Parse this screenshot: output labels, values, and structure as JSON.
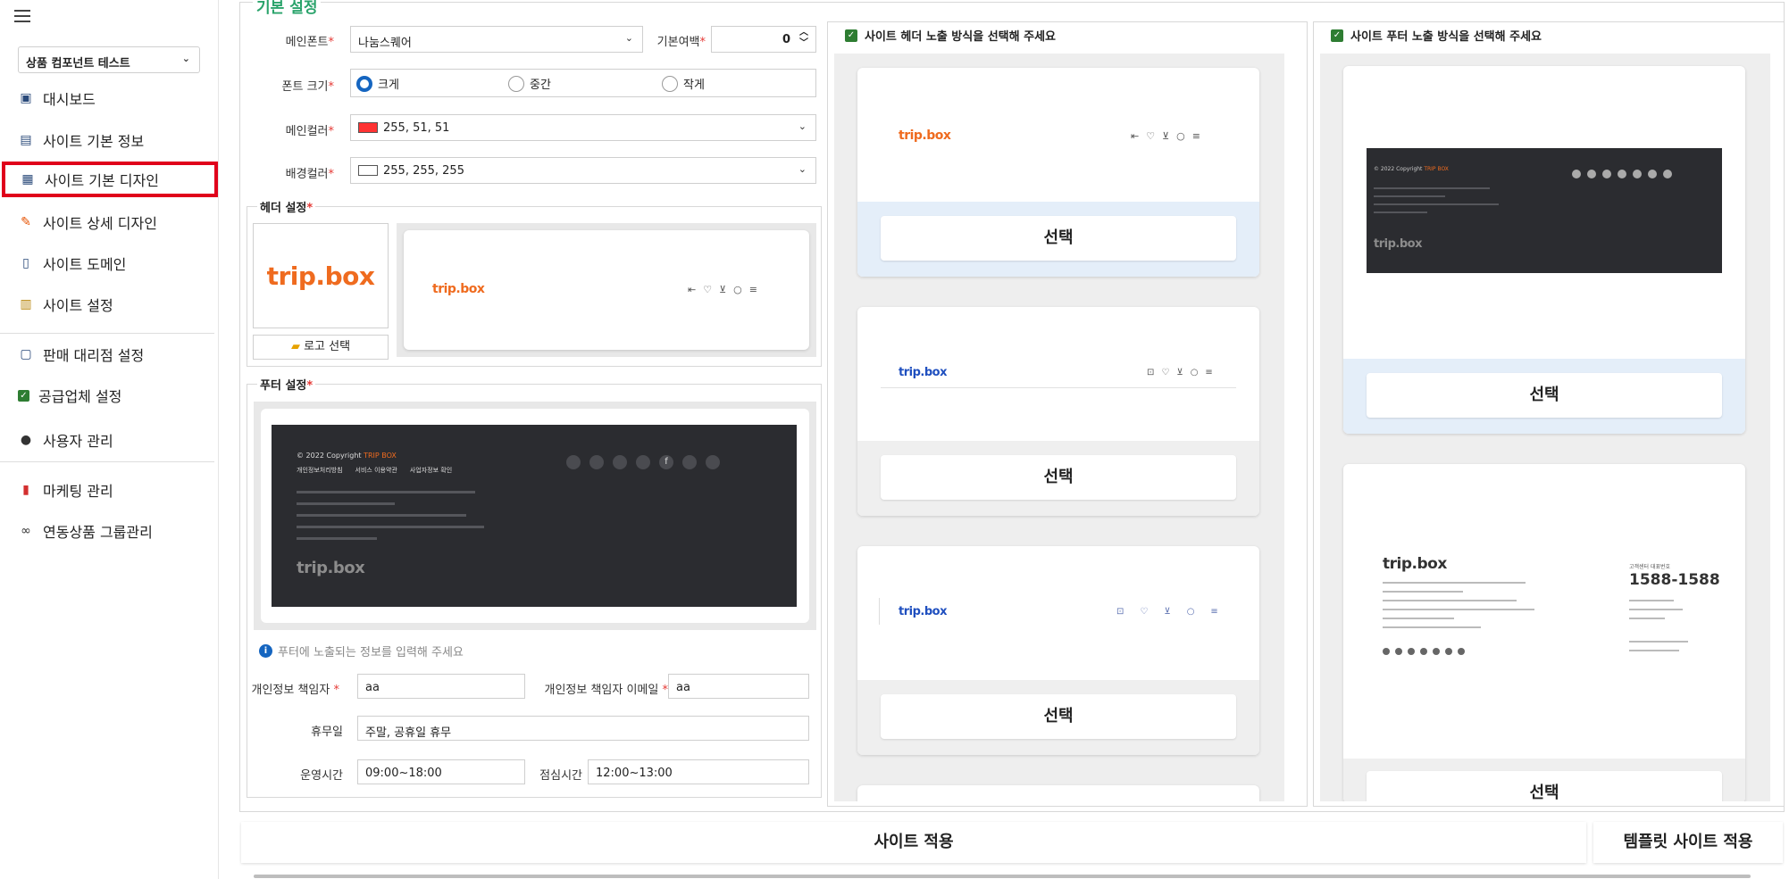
{
  "sidebar": {
    "company_select": "상품 컴포넌트 테스트",
    "items": [
      {
        "label": "대시보드",
        "icon": "dashboard-icon"
      },
      {
        "label": "사이트 기본 정보",
        "icon": "id-card-icon"
      },
      {
        "label": "사이트 기본 디자인",
        "icon": "design-icon"
      },
      {
        "label": "사이트 상세 디자인",
        "icon": "pencil-icon"
      },
      {
        "label": "사이트 도메인",
        "icon": "domain-icon"
      },
      {
        "label": "사이트 설정",
        "icon": "settings-icon"
      },
      {
        "label": "판매 대리점 설정",
        "icon": "store-icon"
      },
      {
        "label": "공급업체 설정",
        "icon": "check-icon"
      },
      {
        "label": "사용자 관리",
        "icon": "user-icon"
      },
      {
        "label": "마케팅 관리",
        "icon": "bookmark-icon"
      },
      {
        "label": "연동상품 그룹관리",
        "icon": "link-icon"
      }
    ],
    "active_index": 2
  },
  "basic": {
    "section_title": "기본 설정",
    "main_font_label": "메인폰트",
    "main_font_value": "나눔스퀘어",
    "margin_label": "기본여백",
    "margin_value": "0",
    "font_size_label": "폰트 크기",
    "font_size_options": [
      "크게",
      "중간",
      "작게"
    ],
    "font_size_selected": 0,
    "main_color_label": "메인컬러",
    "main_color_value": "255, 51, 51",
    "main_color_hex": "#ff3333",
    "bg_color_label": "배경컬러",
    "bg_color_value": "255, 255, 255",
    "bg_color_hex": "#ffffff"
  },
  "header_settings": {
    "title": "헤더 설정",
    "logo_text": "trip.box",
    "logo_button": "로고 선택"
  },
  "footer_settings": {
    "title": "푸터 설정",
    "copyright": "© 2022 Copyright",
    "brand": "TRIP BOX",
    "links": [
      "개인정보처리방침",
      "서비스 이용약관",
      "사업자정보 확인"
    ],
    "logo_text": "trip.box",
    "info_notice": "푸터에 노출되는 정보를 입력해 주세요",
    "privacy_officer_label": "개인정보 책임자",
    "privacy_officer_value": "aa",
    "privacy_email_label": "개인정보 책임자 이메일",
    "privacy_email_value": "aa",
    "holiday_label": "휴무일",
    "holiday_value": "주말, 공휴일 휴무",
    "hours_label": "운영시간",
    "hours_value": "09:00~18:00",
    "lunch_label": "점심시간",
    "lunch_value": "12:00~13:00"
  },
  "header_choices": {
    "title": "사이트 헤더 노출 방식을 선택해 주세요",
    "logo_text": "trip.box",
    "select_label": "선택"
  },
  "footer_choices": {
    "title": "사이트 푸터 노출 방식을 선택해 주세요",
    "logo_text": "trip.box",
    "phone_label": "고객센터 대표번호",
    "phone": "1588-1588",
    "select_label": "선택"
  },
  "actions": {
    "apply": "사이트 적용",
    "template_apply": "템플릿 사이트 적용"
  },
  "colors": {
    "accent_green": "#2aa36b",
    "active_red": "#e0001b",
    "logo_orange": "#ef6b1f",
    "logo_blue": "#1f4fbf",
    "dark_footer": "#2b2c30"
  }
}
